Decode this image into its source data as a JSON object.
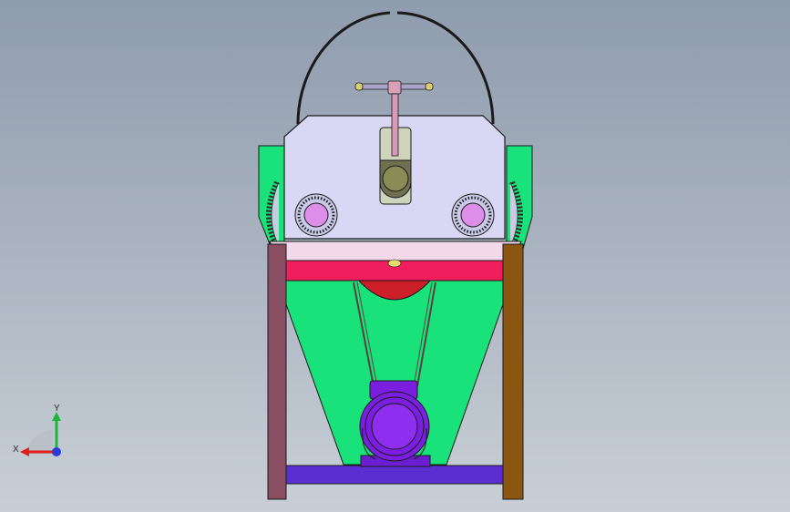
{
  "viewport": {
    "background_top": "#8f9cad",
    "background_bottom": "#c8cfd6"
  },
  "triad": {
    "x_label": "X",
    "y_label": "Y",
    "x_color": "#e0201a",
    "y_color": "#1fb43a",
    "z_color": "#2a3cd8"
  },
  "colors": {
    "frame_housing": "#d8d8f4",
    "guard_green": "#19e27a",
    "hopper_green": "#19e27a",
    "top_plate": "#f3d8ea",
    "red_beam": "#f01e5c",
    "left_leg": "#8a4e63",
    "right_leg": "#8b5512",
    "bottom_beam": "#5a2fd2",
    "motor": "#7a1fe0",
    "bearing": "#dd8ee8",
    "pulley": "#cc1f2a"
  }
}
